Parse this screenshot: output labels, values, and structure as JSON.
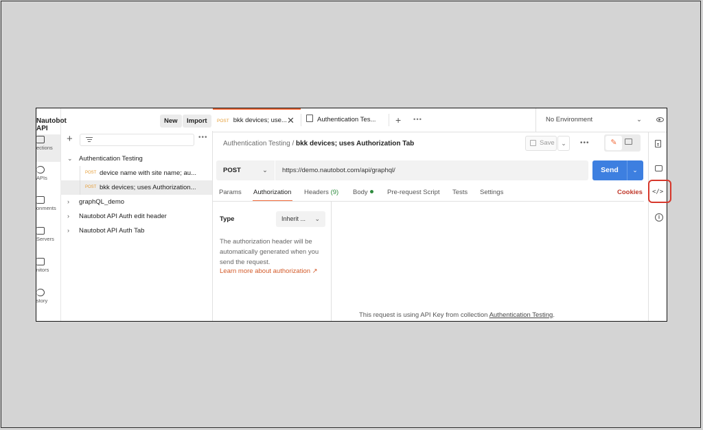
{
  "workspace": {
    "title": "Nautobot API",
    "new_label": "New",
    "import_label": "Import"
  },
  "rail": {
    "items": [
      {
        "label": "ections"
      },
      {
        "label": "APIs"
      },
      {
        "label": "onments"
      },
      {
        "label": "Servers"
      },
      {
        "label": "nitors"
      },
      {
        "label": "story"
      }
    ]
  },
  "sidebar": {
    "tree": [
      {
        "label": "Authentication Testing",
        "expanded": true
      },
      {
        "method": "POST",
        "label": "device name with site name; au..."
      },
      {
        "method": "POST",
        "label": "bkk devices; uses Authorization..."
      },
      {
        "label": "graphQL_demo"
      },
      {
        "label": "Nautobot API Auth edit header"
      },
      {
        "label": "Nautobot API Auth Tab"
      }
    ]
  },
  "tabs": [
    {
      "method": "POST",
      "label": "bkk devices; use..."
    },
    {
      "label": "Authentication Tes..."
    }
  ],
  "environment": "No Environment",
  "breadcrumb": {
    "parent": "Authentication Testing",
    "separator": "/",
    "current": "bkk devices; uses Authorization Tab"
  },
  "toolbar": {
    "save_label": "Save"
  },
  "request": {
    "method": "POST",
    "url": "https://demo.nautobot.com/api/graphql/",
    "send_label": "Send"
  },
  "request_tabs": {
    "params": "Params",
    "authorization": "Authorization",
    "headers": "Headers",
    "headers_count": "(9)",
    "body": "Body",
    "prerequest": "Pre-request Script",
    "tests": "Tests",
    "settings": "Settings",
    "cookies": "Cookies"
  },
  "auth": {
    "type_label": "Type",
    "type_value": "Inherit ...",
    "description": "The authorization header will be automatically generated when you send the request.",
    "link": "Learn more about authorization ↗",
    "note_prefix": "This request is using API Key from collection ",
    "note_collection": "Authentication Testing",
    "note_suffix": "."
  },
  "colors": {
    "accent": "#f26b3a",
    "send": "#3d7fe0",
    "highlight": "#d6362a",
    "method_post": "#e59b31"
  }
}
